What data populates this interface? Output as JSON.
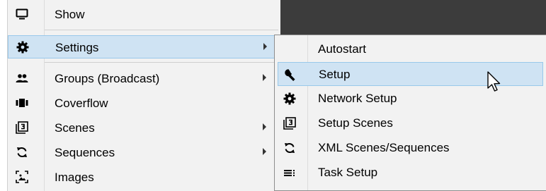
{
  "main_menu": {
    "items": [
      {
        "label": "Show",
        "icon": "monitor-icon",
        "has_submenu": false
      },
      {
        "label": "Settings",
        "icon": "gear-icon",
        "has_submenu": true,
        "highlighted": true
      },
      {
        "label": "Groups (Broadcast)",
        "icon": "group-icon",
        "has_submenu": true
      },
      {
        "label": "Coverflow",
        "icon": "coverflow-icon",
        "has_submenu": false
      },
      {
        "label": "Scenes",
        "icon": "scenes-icon",
        "has_submenu": true
      },
      {
        "label": "Sequences",
        "icon": "sequences-icon",
        "has_submenu": true
      },
      {
        "label": "Images",
        "icon": "images-icon",
        "has_submenu": false
      }
    ]
  },
  "settings_submenu": {
    "items": [
      {
        "label": "Autostart",
        "icon": ""
      },
      {
        "label": "Setup",
        "icon": "wrench-icon",
        "highlighted": true
      },
      {
        "label": "Network Setup",
        "icon": "gear-icon"
      },
      {
        "label": "Setup Scenes",
        "icon": "scenes-icon"
      },
      {
        "label": "XML Scenes/Sequences",
        "icon": "sequences-icon"
      },
      {
        "label": "Task Setup",
        "icon": "task-list-icon"
      }
    ]
  },
  "colors": {
    "menu_bg": "#f2f2f2",
    "highlight_bg": "#cfe3f3",
    "highlight_border": "#99c8ea",
    "background": "#3c3c3c"
  }
}
